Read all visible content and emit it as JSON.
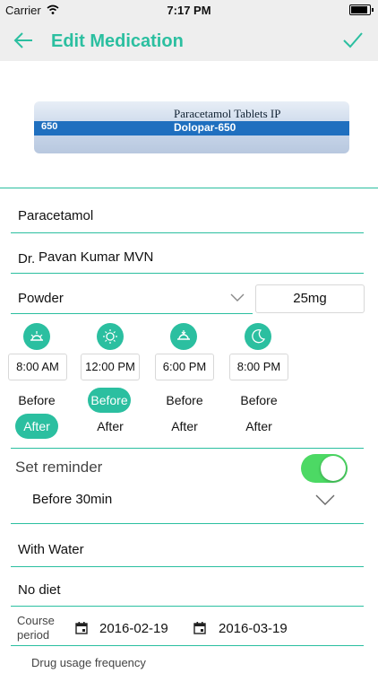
{
  "status": {
    "carrier": "Carrier",
    "time": "7:17 PM"
  },
  "nav": {
    "title": "Edit Medication"
  },
  "image": {
    "line1": "Paracetamol",
    "line2": "Tablets IP",
    "brand": "Dolopar-650",
    "left_brand": "650"
  },
  "medicine_name": "Paracetamol",
  "doctor": {
    "prefix": "Dr.",
    "name": "Pavan Kumar MVN"
  },
  "form": {
    "type": "Powder",
    "dose": "25mg"
  },
  "schedule": [
    {
      "icon": "sunrise-icon",
      "time": "8:00 AM",
      "before": "Before",
      "after": "After",
      "selected": "after"
    },
    {
      "icon": "sun-icon",
      "time": "12:00 PM",
      "before": "Before",
      "after": "After",
      "selected": "before"
    },
    {
      "icon": "sunset-icon",
      "time": "6:00 PM",
      "before": "Before",
      "after": "After",
      "selected": "none"
    },
    {
      "icon": "moon-icon",
      "time": "8:00 PM",
      "before": "Before",
      "after": "After",
      "selected": "none"
    }
  ],
  "reminder": {
    "label": "Set reminder",
    "enabled": true,
    "offset": "Before 30min"
  },
  "with_water": "With Water",
  "diet": "No diet",
  "course": {
    "label_line1": "Course",
    "label_line2": "period",
    "start": "2016-02-19",
    "end": "2016-03-19"
  },
  "frequency_label": "Drug usage frequency",
  "colors": {
    "accent": "#2bbfa0",
    "toggle_on": "#4cd964"
  }
}
